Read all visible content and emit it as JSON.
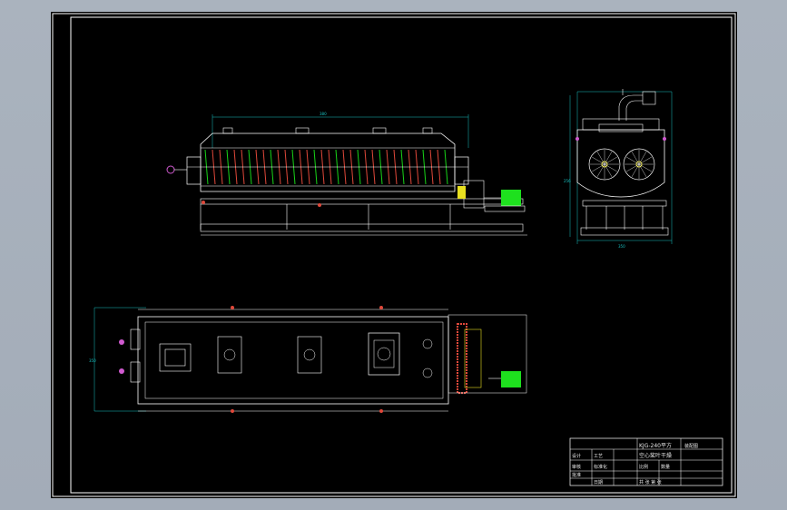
{
  "colors": {
    "background": "#aab3be",
    "paper": "#000000",
    "frame": "#ffffff",
    "geometry": "#ffffff",
    "dimension": "#19c3c3",
    "hatch": "#e0483a",
    "green": "#18d418",
    "motor": "#1ee01e",
    "magenta": "#d05ad0",
    "yellow": "#e8e020"
  },
  "views": {
    "front": "front-elevation",
    "side": "side-elevation",
    "plan": "plan-view"
  },
  "dimensions": {
    "front_overall": "380",
    "side_height": "256",
    "side_width": "350",
    "plan_width": "350"
  },
  "title_block": {
    "title_line1": "KJG-240平方",
    "title_line2": "空心桨叶干燥",
    "drawing_no": "装配图",
    "scale_label": "比例",
    "qty_label": "数量",
    "sheet_label": "共 张 第 张",
    "designer_label": "设计",
    "checker_label": "审核",
    "approver_label": "批准",
    "craft_label": "工艺",
    "standard_label": "标准化",
    "date_label": "日期"
  }
}
